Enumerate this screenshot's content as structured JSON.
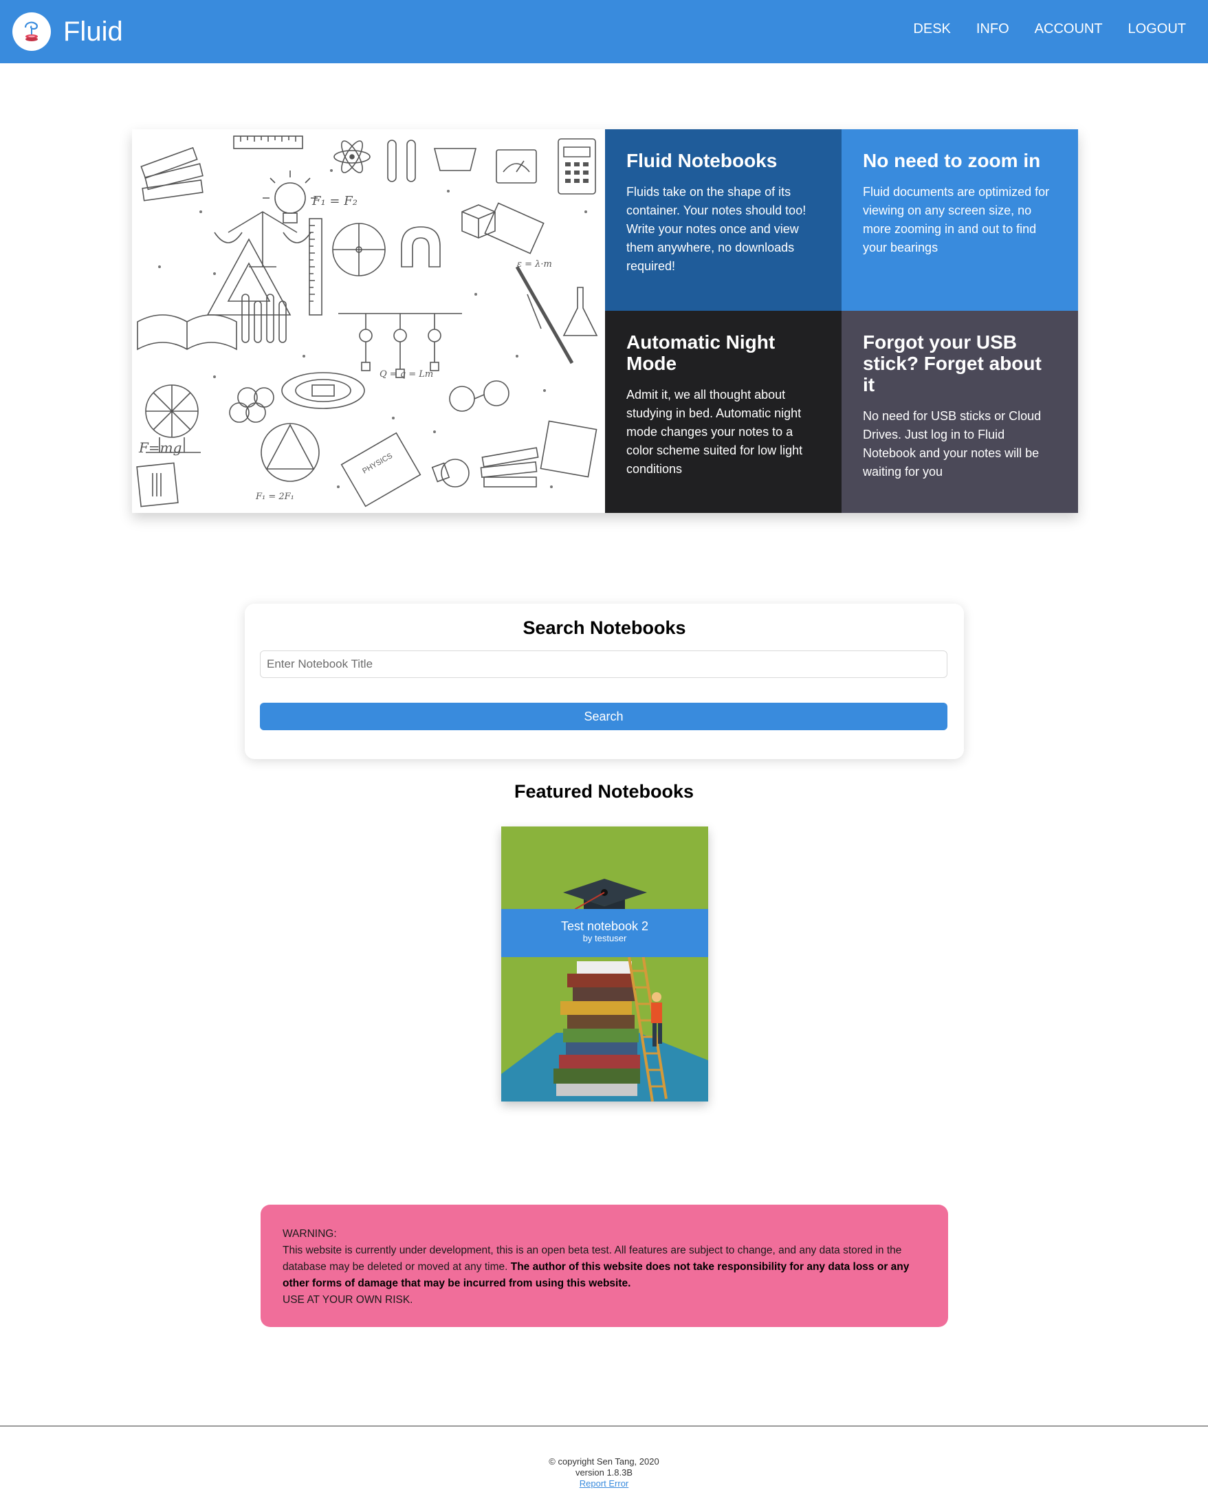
{
  "nav": {
    "brand": "Fluid",
    "links": [
      "DESK",
      "INFO",
      "ACCOUNT",
      "LOGOUT"
    ]
  },
  "hero": {
    "tiles": [
      {
        "title": "Fluid Notebooks",
        "body": "Fluids take on the shape of its container. Your notes should too! Write your notes once and view them anywhere, no downloads required!",
        "color": "#1f5c9a"
      },
      {
        "title": "No need to zoom in",
        "body": "Fluid documents are optimized for viewing on any screen size, no more zooming in and out to find your bearings",
        "color": "#398bdd"
      },
      {
        "title": "Automatic Night Mode",
        "body": "Admit it, we all thought about studying in bed. Automatic night mode changes your notes to a color scheme suited for low light conditions",
        "color": "#202022"
      },
      {
        "title": "Forgot your USB stick? Forget about it",
        "body": "No need for USB sticks or Cloud Drives. Just log in to Fluid Notebook and your notes will be waiting for you",
        "color": "#4b4958"
      }
    ],
    "illustration_labels": [
      "PHYSICS",
      "F=mg",
      "F₁ = 2F₁"
    ]
  },
  "search": {
    "title": "Search Notebooks",
    "placeholder": "Enter Notebook Title",
    "value": "",
    "button": "Search"
  },
  "featured": {
    "title": "Featured Notebooks",
    "notebooks": [
      {
        "title": "Test notebook 2",
        "author": "by testuser"
      }
    ]
  },
  "warning": {
    "heading": "WARNING:",
    "text": "This website is currently under development, this is an open beta test. All features are subject to change, and any data stored in the database may be deleted or moved at any time.",
    "bold": "The author of this website does not take responsibility for any data loss or any other forms of damage that may be incurred from using this website.",
    "footer": "USE AT YOUR OWN RISK.",
    "color": "#f06e9a"
  },
  "footer": {
    "copyright": "© copyright Sen Tang, 2020",
    "version": "version 1.8.3B",
    "report": "Report Error"
  },
  "colors": {
    "accent": "#398bdd",
    "dark_blue": "#1f5c9a"
  }
}
